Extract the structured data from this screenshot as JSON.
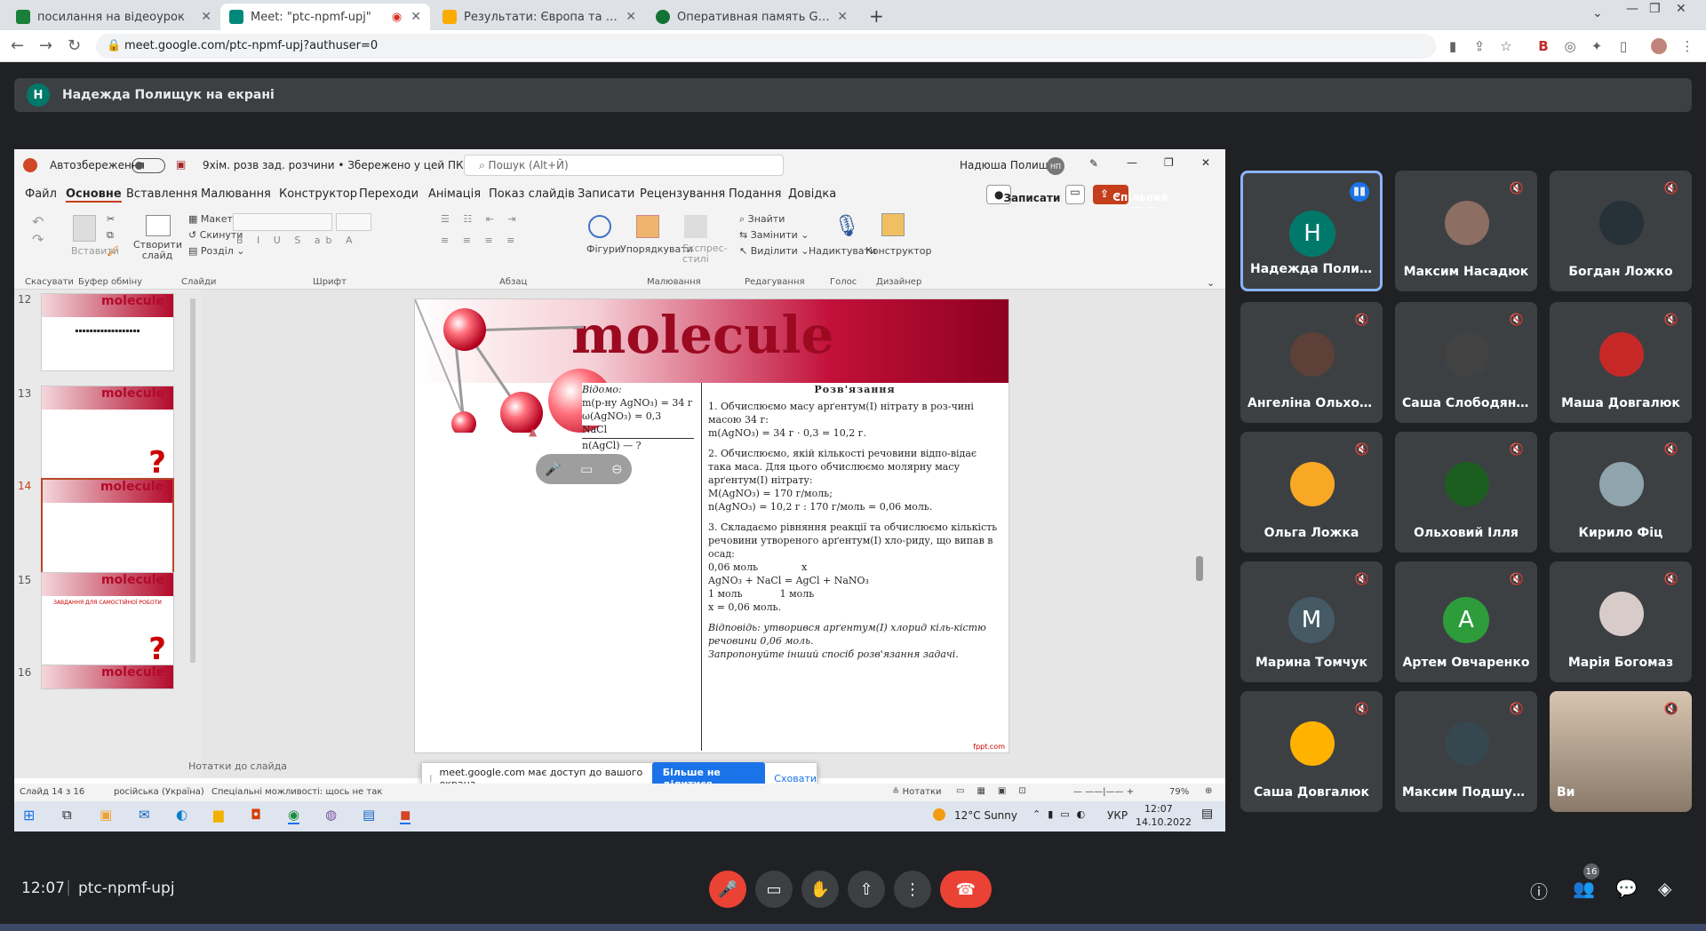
{
  "browser": {
    "tabs": [
      {
        "title": "посилання на відеоурок",
        "fav_color": "#188038"
      },
      {
        "title": "Meet: \"ptc-npmf-upj\"",
        "fav_color": "#00897b"
      },
      {
        "title": "Результати: Європа та Америка",
        "fav_color": "#f9ab00"
      },
      {
        "title": "Оперативная память Golden Me",
        "fav_color": "#137333"
      }
    ],
    "url": "meet.google.com/ptc-npmf-upj?authuser=0"
  },
  "meet": {
    "presenting_banner": "Надежда Полищук на екрані",
    "presenter_initial": "Н",
    "time": "12:07",
    "meeting_code": "ptc-npmf-upj",
    "participants_count": "16",
    "participants": [
      {
        "name": "Надежда Полищ...",
        "initial": "Н",
        "color": "#00796b",
        "speaking": true
      },
      {
        "name": "Максим Насадюк",
        "color": "#8d6e63"
      },
      {
        "name": "Богдан Ложко",
        "color": "#263238"
      },
      {
        "name": "Ангеліна Ольхова",
        "color": "#5d4037"
      },
      {
        "name": "Саша Слободяник",
        "color": "#424242"
      },
      {
        "name": "Маша Довгалюк",
        "color": "#c62828"
      },
      {
        "name": "Ольга Ложка",
        "color": "#f9a825"
      },
      {
        "name": "Ольховий Ілля",
        "color": "#1b5e20"
      },
      {
        "name": "Кирило Фіц",
        "color": "#90a4ae"
      },
      {
        "name": "Марина Томчук",
        "initial": "M",
        "color": "#455a64"
      },
      {
        "name": "Артем Овчаренко",
        "initial": "A",
        "color": "#2e9c3b"
      },
      {
        "name": "Марія Богомаз",
        "color": "#d7ccc8"
      },
      {
        "name": "Саша Довгалюк",
        "color": "#ffb300"
      },
      {
        "name": "Максим Подшум...",
        "color": "#37474f"
      },
      {
        "name": "Ви",
        "color": "#a1887f"
      }
    ]
  },
  "ppt": {
    "autosave": "Автозбереження",
    "filename": "9хім. розв зад. розчини • Збережено у цей ПК ⌄",
    "search": "Пошук (Alt+Й)",
    "user": "Надюша Полищук",
    "user_initials": "НП",
    "menu": [
      "Файл",
      "Основне",
      "Вставлення",
      "Малювання",
      "Конструктор",
      "Переходи",
      "Анімація",
      "Показ слайдів",
      "Записати",
      "Рецензування",
      "Подання",
      "Довідка"
    ],
    "record_btn": "Записати",
    "share_btn": "Спільний доступ",
    "groups": [
      "Скасувати",
      "Буфер обміну",
      "Слайди",
      "Шрифт",
      "Абзац",
      "Малювання",
      "Редагування",
      "Голос",
      "Дизайнер"
    ],
    "ribbon_labels": {
      "paste": "Вставити",
      "new_slide": "Створити слайд",
      "layout": "Макет",
      "reset": "Скинути",
      "section": "Розділ",
      "shapes": "Фігури",
      "arrange": "Упорядкувати",
      "styles": "Експрес-стилі",
      "find": "Знайти",
      "replace": "Замінити",
      "select": "Виділити",
      "dictate": "Надиктувати",
      "designer": "Конструктор"
    },
    "thumb_numbers": [
      "12",
      "13",
      "14",
      "15",
      "16"
    ],
    "thumb_15_title": "ЗАВДАННЯ ДЛЯ САМОСТІЙНОЇ РОБОТИ",
    "notes": "Нотатки до слайда",
    "status_slide": "Слайд 14 з 16",
    "status_lang": "російська (Україна)",
    "status_access": "Спеціальні можливості: щось не так",
    "status_notes": "Нотатки",
    "zoom": "79%",
    "share_msg": "meet.google.com має доступ до вашого екрана.",
    "stop_share": "Більше не ділитися",
    "hide": "Сховати",
    "weather": "12°C  Sunny",
    "lang": "УКР",
    "clock_time": "12:07",
    "clock_date": "14.10.2022"
  },
  "slide": {
    "banner": "molecule",
    "known_title": "Відомо:",
    "known_lines": [
      "m(р-ну AgNO₃) = 34 г",
      "ω(AgNO₃) = 0,3",
      "NaCl"
    ],
    "unknown": "n(AgCl) — ?",
    "solution_title": "Розв'язання",
    "steps": [
      "1. Обчислюємо масу арґентум(І) нітрату в роз-чині масою 34 г:",
      "m(AgNO₃) = 34 г · 0,3 = 10,2 г.",
      "2. Обчислюємо, якій кількості речовини відпо-відає така маса. Для цього обчислюємо молярну масу арґентум(І) нітрату:",
      "M(AgNO₃) = 170 г/моль;",
      "n(AgNO₃) = 10,2 г : 170 г/моль = 0,06 моль.",
      "3. Складаємо рівняння реакції та обчислюємо кількість речовини утвореного арґентум(І) хло-риду, що випав в осад:",
      "0,06 моль              x",
      "AgNO₃ + NaCl = AgCl + NaNO₃",
      "1 моль            1 моль",
      "x = 0,06 моль.",
      "Відповідь: утворився арґентум(І) хлорид кіль-кістю речовини 0,06 моль.",
      "Запропонуйте інший спосіб розв'язання задачі."
    ],
    "footer": "fppt.com"
  }
}
